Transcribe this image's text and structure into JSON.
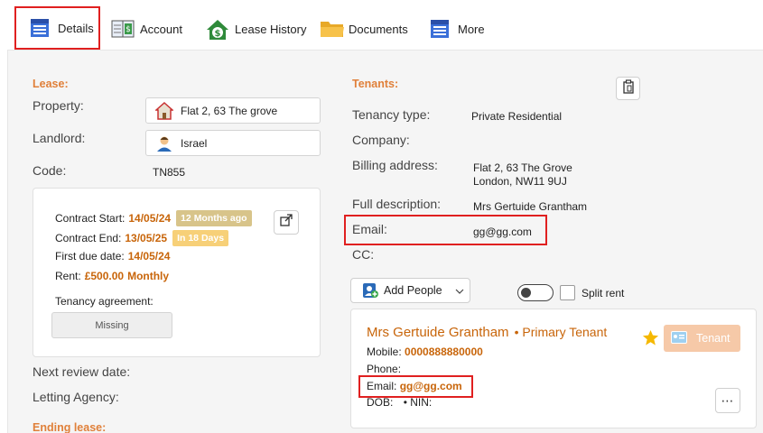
{
  "toolbar": {
    "tabs": [
      {
        "label": "Details",
        "icon": "list-icon",
        "selected": true
      },
      {
        "label": "Account",
        "icon": "ledger-icon"
      },
      {
        "label": "Lease History",
        "icon": "house-dollar-icon"
      },
      {
        "label": "Documents",
        "icon": "folder-icon"
      },
      {
        "label": "More",
        "icon": "list-icon"
      }
    ]
  },
  "lease": {
    "title": "Lease:",
    "property_label": "Property:",
    "property_value": "Flat 2, 63 The grove",
    "landlord_label": "Landlord:",
    "landlord_value": "Israel",
    "code_label": "Code:",
    "code_value": "TN855",
    "contract": {
      "start_label": "Contract Start:",
      "start_value": "14/05/24",
      "start_badge": "12 Months ago",
      "end_label": "Contract End:",
      "end_value": "13/05/25",
      "end_badge": "In 18 Days",
      "first_due_label": "First due date:",
      "first_due_value": "14/05/24",
      "rent_label": "Rent:",
      "rent_value": "£500.00",
      "rent_period": "Monthly",
      "agreement_label": "Tenancy agreement:",
      "agreement_button": "Missing"
    },
    "next_review_label": "Next review date:",
    "letting_agency_label": "Letting Agency:",
    "ending_title": "Ending lease:"
  },
  "tenants": {
    "title": "Tenants:",
    "tenancy_type_label": "Tenancy type:",
    "tenancy_type_value": "Private Residential",
    "company_label": "Company:",
    "billing_label": "Billing address:",
    "billing_line1": "Flat 2, 63 The Grove",
    "billing_line2": "London, NW11 9UJ",
    "full_desc_label": "Full description:",
    "full_desc_value": "Mrs Gertuide Grantham",
    "email_label": "Email:",
    "email_value": "gg@gg.com",
    "cc_label": "CC:",
    "add_people_label": "Add People",
    "split_rent_label": "Split rent",
    "split_rent_on": false
  },
  "tenant_card": {
    "name": "Mrs Gertuide Grantham",
    "role": "• Primary Tenant",
    "mobile_label": "Mobile:",
    "mobile_value": "0000888880000",
    "phone_label": "Phone:",
    "email_label": "Email:",
    "email_value": "gg@gg.com",
    "dob_label": "DOB:",
    "nin_label": "• NIN:",
    "badge_label": "Tenant"
  },
  "colors": {
    "accent": "#e0803a",
    "value_orange": "#c8650a",
    "highlight_red": "#e02020"
  }
}
